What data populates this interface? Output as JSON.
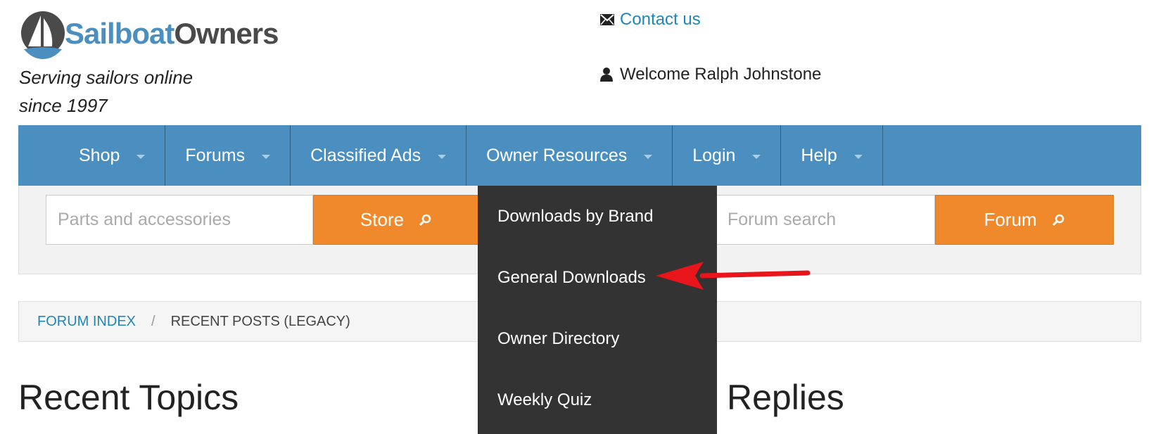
{
  "header": {
    "logo_sail": "Sailboat",
    "logo_owners": "Owners",
    "tagline_line1": "Serving sailors online",
    "tagline_line2": "since 1997",
    "contact_label": "Contact us",
    "welcome_text": "Welcome Ralph Johnstone"
  },
  "nav": {
    "items": [
      {
        "label": "Shop"
      },
      {
        "label": "Forums"
      },
      {
        "label": "Classified Ads"
      },
      {
        "label": "Owner Resources"
      },
      {
        "label": "Login"
      },
      {
        "label": "Help"
      }
    ]
  },
  "search": {
    "store_placeholder": "Parts and accessories",
    "store_button": "Store",
    "forum_placeholder": "Forum search",
    "forum_button": "Forum"
  },
  "dropdown": {
    "items": [
      {
        "label": "Downloads by Brand"
      },
      {
        "label": "General Downloads"
      },
      {
        "label": "Owner Directory"
      },
      {
        "label": "Weekly Quiz"
      }
    ]
  },
  "breadcrumb": {
    "root": "FORUM INDEX",
    "separator": "/",
    "current": "RECENT POSTS (LEGACY)"
  },
  "main": {
    "left_heading": "Recent Topics",
    "right_heading": "Replies"
  },
  "colors": {
    "nav_bg": "#4a8fbf",
    "button_orange": "#f0892b",
    "dropdown_bg": "#333333",
    "link_blue": "#1e87b8",
    "arrow_red": "#e8151b"
  }
}
